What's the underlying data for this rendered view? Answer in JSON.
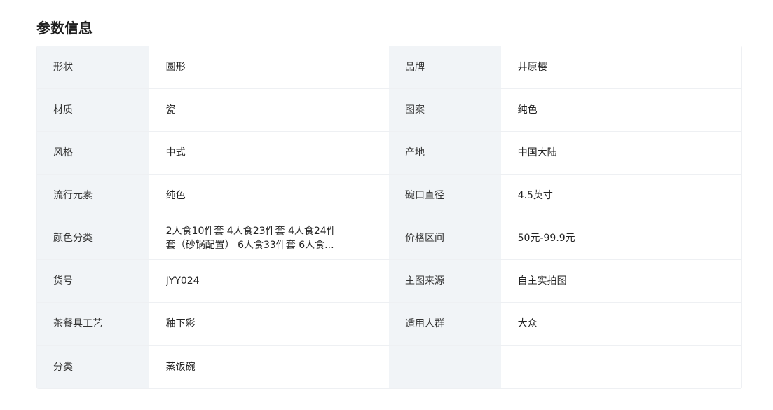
{
  "section": {
    "title": "参数信息"
  },
  "params": [
    {
      "label_left": "形状",
      "value_left": "圆形",
      "label_right": "品牌",
      "value_right": "井原樱"
    },
    {
      "label_left": "材质",
      "value_left": "瓷",
      "label_right": "图案",
      "value_right": "纯色"
    },
    {
      "label_left": "风格",
      "value_left": "中式",
      "label_right": "产地",
      "value_right": "中国大陆"
    },
    {
      "label_left": "流行元素",
      "value_left": "纯色",
      "label_right": "碗口直径",
      "value_right": "4.5英寸"
    },
    {
      "label_left": "颜色分类",
      "value_left": "2人食10件套 4人食23件套 4人食24件套（砂锅配置） 6人食33件套 6人食...",
      "label_right": "价格区间",
      "value_right": "50元-99.9元"
    },
    {
      "label_left": "货号",
      "value_left": "JYY024",
      "label_right": "主图来源",
      "value_right": "自主实拍图"
    },
    {
      "label_left": "茶餐具工艺",
      "value_left": "釉下彩",
      "label_right": "适用人群",
      "value_right": "大众"
    },
    {
      "label_left": "分类",
      "value_left": "蒸饭碗",
      "label_right": "",
      "value_right": ""
    }
  ]
}
